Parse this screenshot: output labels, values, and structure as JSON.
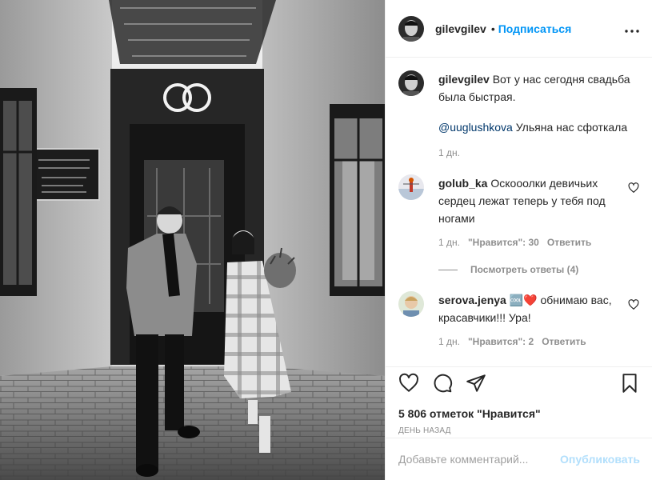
{
  "post": {
    "author": "gilevgilev",
    "follow_label": "Подписаться",
    "dot": "•",
    "more_label": "•••"
  },
  "caption": {
    "username": "gilevgilev",
    "text": "Вот у нас сегодня свадьба была быстрая.",
    "mention": "@uuglushkova",
    "mention_text": " Ульяна нас сфоткала",
    "time": "1 дн."
  },
  "comments": [
    {
      "username": "golub_ka",
      "text": "Оскооолки девичьих сердец лежат теперь у тебя под ногами",
      "time": "1 дн.",
      "likes": "\"Нравится\": 30",
      "reply": "Ответить",
      "view_replies": "Посмотреть ответы (4)"
    },
    {
      "username": "serova.jenya",
      "text": "🆒❤️ обнимаю вас, красавчики!!! Ура!",
      "time": "1 дн.",
      "likes": "\"Нравится\": 2",
      "reply": "Ответить"
    }
  ],
  "stats": {
    "likes": "5 806 отметок \"Нравится\"",
    "date": "ДЕНЬ НАЗАД"
  },
  "add_comment": {
    "placeholder": "Добавьте комментарий...",
    "publish_label": "Опубликовать"
  },
  "colors": {
    "accent": "#0095f6",
    "publish_disabled": "#b2dffc",
    "muted": "#8e8e8e",
    "text": "#262626"
  },
  "icons": [
    "heart-icon",
    "comment-icon",
    "share-icon",
    "bookmark-icon",
    "more-icon",
    "small-heart-icon"
  ]
}
